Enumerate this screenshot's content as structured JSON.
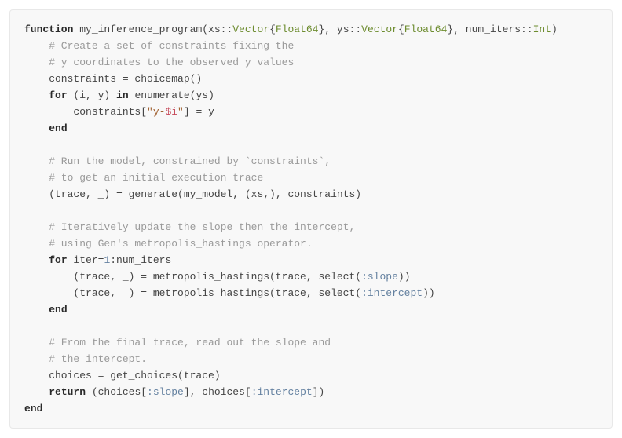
{
  "code": {
    "kw_function": "function",
    "fn_name": " my_inference_program(xs",
    "dc1": "::",
    "ty_vec": "Vector",
    "br_open": "{",
    "ty_f64": "Float64",
    "br_close": "}",
    "comma_ys": ", ys",
    "dc2": "::",
    "comma_ni": ", num_iters",
    "dc3": "::",
    "ty_int": "Int",
    "paren_close": ")",
    "c1": "    # Create a set of constraints fixing the",
    "c2": "    # y coordinates to the observed y values",
    "l3": "    constraints = choicemap()",
    "l4a": "    ",
    "kw_for1": "for",
    "l4b": " (i, y) ",
    "kw_in": "in",
    "l4c": " enumerate(ys)",
    "l5a": "        constraints[",
    "str_y": "\"y-",
    "interp": "$i",
    "str_end": "\"",
    "l5b": "] = y",
    "l6a": "    ",
    "kw_end1": "end",
    "blank": "",
    "c3": "    # Run the model, constrained by `constraints`,",
    "c4": "    # to get an initial execution trace",
    "l9": "    (trace, _) = generate(my_model, (xs,), constraints)",
    "c5": "    # Iteratively update the slope then the intercept,",
    "c6": "    # using Gen's metropolis_hastings operator.",
    "l12a": "    ",
    "kw_for2": "for",
    "l12b": " iter=",
    "num1": "1",
    "l12c": ":num_iters",
    "l13a": "        (trace, _) = metropolis_hastings(trace, select(",
    "sym_slope": ":slope",
    "l13b": "))",
    "l14a": "        (trace, _) = metropolis_hastings(trace, select(",
    "sym_int": ":intercept",
    "l14b": "))",
    "l15a": "    ",
    "kw_end2": "end",
    "c7": "    # From the final trace, read out the slope and",
    "c8": "    # the intercept.",
    "l18": "    choices = get_choices(trace)",
    "l19a": "    ",
    "kw_return": "return",
    "l19b": " (choices[",
    "sym_slope2": ":slope",
    "l19c": "], choices[",
    "sym_int2": ":intercept",
    "l19d": "])",
    "kw_end3": "end"
  }
}
